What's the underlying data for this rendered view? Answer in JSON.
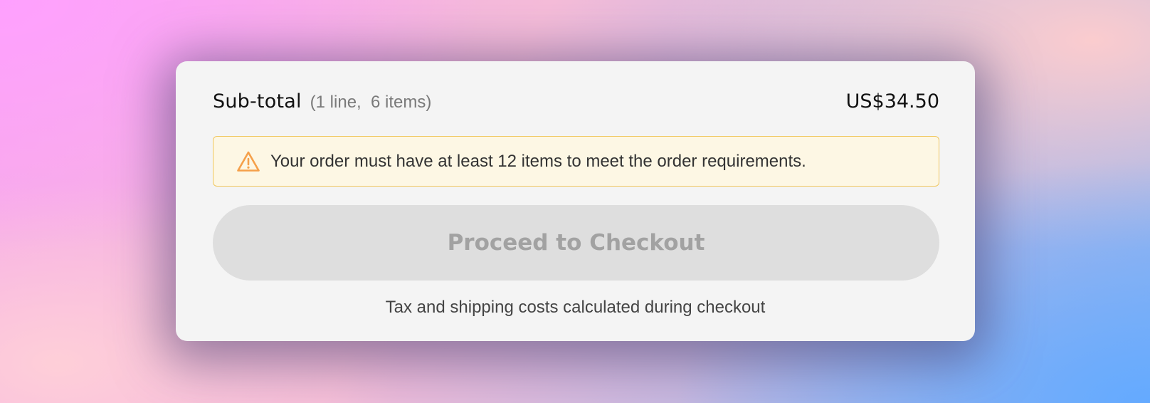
{
  "summary": {
    "subtotal_label": "Sub-total",
    "subtotal_count": "(1 line,  6 items)",
    "subtotal_price": "US$34.50"
  },
  "warning": {
    "icon": "warning-triangle-icon",
    "message": "Your order must have at least 12 items to meet the order requirements.",
    "accent_color": "#f5a04a",
    "border_color": "#f0c75e",
    "background_color": "#fdf7e4"
  },
  "checkout": {
    "button_label": "Proceed to Checkout",
    "state": "disabled"
  },
  "footer": {
    "tax_note": "Tax and shipping costs calculated during checkout"
  }
}
